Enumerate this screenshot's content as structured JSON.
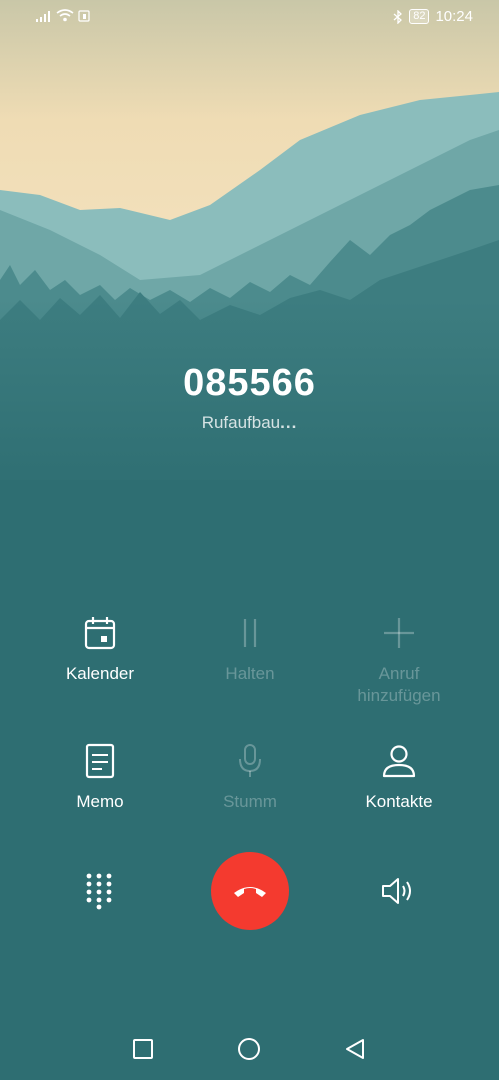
{
  "status_bar": {
    "battery": "82",
    "time": "10:24",
    "icons": [
      "signal-icon",
      "wifi-icon",
      "sim-icon",
      "bluetooth-icon",
      "battery-icon"
    ]
  },
  "call": {
    "number": "085566",
    "status": "Rufaufbau",
    "status_dots": "..."
  },
  "actions": {
    "calendar": "Kalender",
    "hold": "Halten",
    "add_call_line1": "Anruf",
    "add_call_line2": "hinzufügen",
    "memo": "Memo",
    "mute": "Stumm",
    "contacts": "Kontakte"
  },
  "colors": {
    "background": "#2e6e72",
    "hangup": "#f43a2f"
  }
}
